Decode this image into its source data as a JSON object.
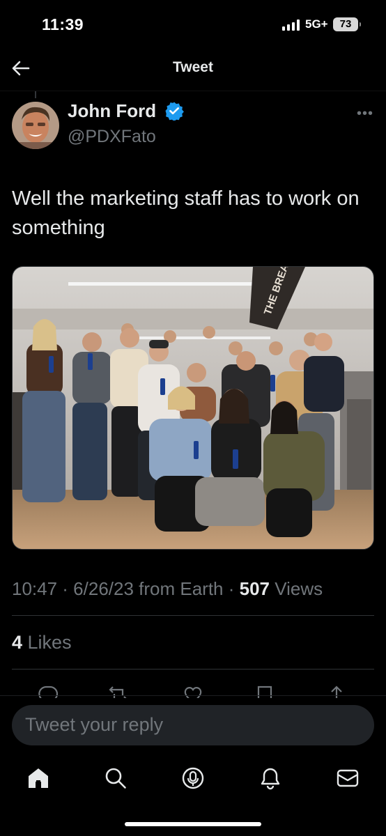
{
  "status_bar": {
    "time": "11:39",
    "network": "5G+",
    "battery": "73"
  },
  "header": {
    "title": "Tweet"
  },
  "tweet": {
    "author_name": "John Ford",
    "handle": "@PDXFato",
    "text": "Well the marketing staff has to work on something",
    "timestamp": "10:47 · 6/26/23 from Earth · ",
    "views_count": "507",
    "views_label": " Views",
    "likes_count": "4",
    "likes_label": " Likes",
    "banner_text": "THE BREAKR"
  },
  "reply": {
    "placeholder": "Tweet your reply"
  },
  "icons": [
    "back-arrow-icon",
    "verified-icon",
    "more-icon",
    "reply-icon",
    "retweet-icon",
    "like-icon",
    "bookmark-icon",
    "share-icon",
    "home-icon",
    "search-icon",
    "spaces-icon",
    "notifications-icon",
    "messages-icon"
  ],
  "colors": {
    "background": "#000000",
    "text": "#e7e9ea",
    "muted": "#71767b",
    "verified": "#1d9bf0"
  }
}
